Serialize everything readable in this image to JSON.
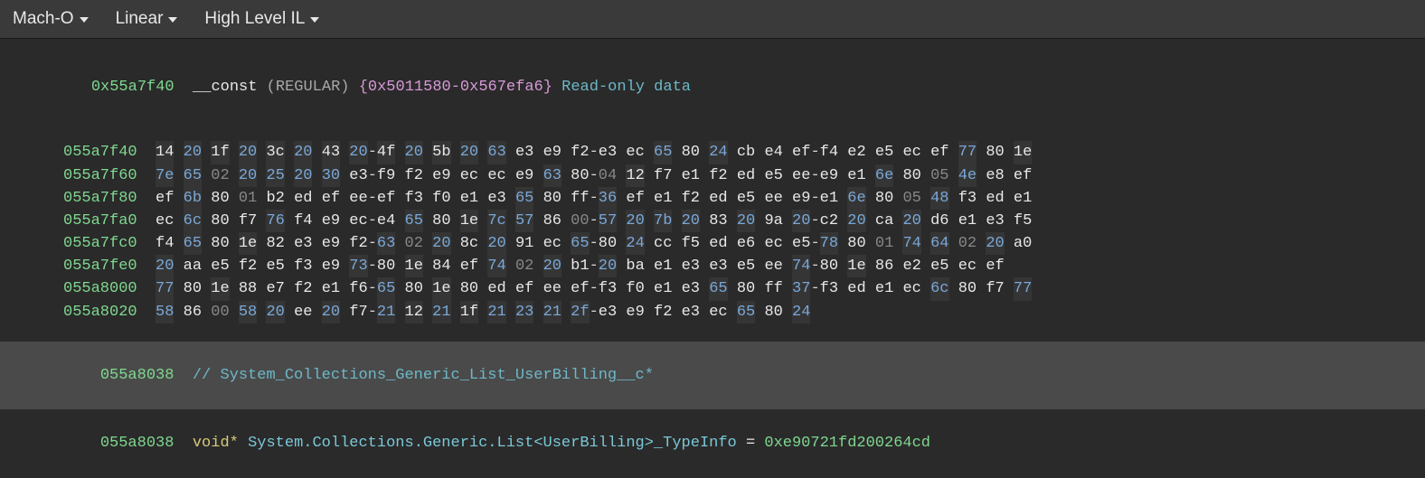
{
  "toolbar": {
    "format": "Mach-O",
    "view": "Linear",
    "il": "High Level IL"
  },
  "header": {
    "addr": "0x55a7f40",
    "section": "__const",
    "type": "(REGULAR)",
    "range": "{0x5011580-0x567efa6}",
    "desc": "Read-only data"
  },
  "rows": [
    {
      "addr": "055a7f40",
      "b": [
        {
          "v": "14",
          "c": "b-hi"
        },
        {
          "v": "20",
          "c": "b-blu"
        },
        {
          "v": "1f",
          "c": "b-hi"
        },
        {
          "v": "20",
          "c": "b-blu"
        },
        {
          "v": "3c",
          "c": "b-hi"
        },
        {
          "v": "20",
          "c": "b-blu"
        },
        {
          "v": "43",
          "c": "b-hi"
        },
        {
          "v": "20",
          "c": "b-blu",
          "d": true
        },
        {
          "v": "4f",
          "c": "b-hi"
        },
        {
          "v": "20",
          "c": "b-blu"
        },
        {
          "v": "5b",
          "c": "b-hi"
        },
        {
          "v": "20",
          "c": "b-blu"
        },
        {
          "v": "63",
          "c": "b-hib"
        },
        {
          "v": "e3",
          "c": "b-pl"
        },
        {
          "v": "e9",
          "c": "b-pl"
        },
        {
          "v": "f2",
          "c": "b-pl",
          "d": true
        },
        {
          "v": "e3",
          "c": "b-pl"
        },
        {
          "v": "ec",
          "c": "b-pl"
        },
        {
          "v": "65",
          "c": "b-hib"
        },
        {
          "v": "80",
          "c": "b-pl"
        },
        {
          "v": "24",
          "c": "b-hib"
        },
        {
          "v": "cb",
          "c": "b-pl"
        },
        {
          "v": "e4",
          "c": "b-pl"
        },
        {
          "v": "ef",
          "c": "b-pl",
          "d": true
        },
        {
          "v": "f4",
          "c": "b-pl"
        },
        {
          "v": "e2",
          "c": "b-pl"
        },
        {
          "v": "e5",
          "c": "b-pl"
        },
        {
          "v": "ec",
          "c": "b-pl"
        },
        {
          "v": "ef",
          "c": "b-pl"
        },
        {
          "v": "77",
          "c": "b-hib"
        },
        {
          "v": "80",
          "c": "b-pl"
        },
        {
          "v": "1e",
          "c": "b-hi"
        }
      ]
    },
    {
      "addr": "055a7f60",
      "b": [
        {
          "v": "7e",
          "c": "b-hib"
        },
        {
          "v": "65",
          "c": "b-hib"
        },
        {
          "v": "02",
          "c": "b-dim"
        },
        {
          "v": "20",
          "c": "b-blu"
        },
        {
          "v": "25",
          "c": "b-hib"
        },
        {
          "v": "20",
          "c": "b-blu"
        },
        {
          "v": "30",
          "c": "b-hib"
        },
        {
          "v": "e3",
          "c": "b-pl",
          "d": true
        },
        {
          "v": "f9",
          "c": "b-pl"
        },
        {
          "v": "f2",
          "c": "b-pl"
        },
        {
          "v": "e9",
          "c": "b-pl"
        },
        {
          "v": "ec",
          "c": "b-pl"
        },
        {
          "v": "ec",
          "c": "b-pl"
        },
        {
          "v": "e9",
          "c": "b-pl"
        },
        {
          "v": "63",
          "c": "b-hib"
        },
        {
          "v": "80",
          "c": "b-pl",
          "d": true
        },
        {
          "v": "04",
          "c": "b-dim"
        },
        {
          "v": "12",
          "c": "b-hi"
        },
        {
          "v": "f7",
          "c": "b-pl"
        },
        {
          "v": "e1",
          "c": "b-pl"
        },
        {
          "v": "f2",
          "c": "b-pl"
        },
        {
          "v": "ed",
          "c": "b-pl"
        },
        {
          "v": "e5",
          "c": "b-pl"
        },
        {
          "v": "ee",
          "c": "b-pl",
          "d": true
        },
        {
          "v": "e9",
          "c": "b-pl"
        },
        {
          "v": "e1",
          "c": "b-pl"
        },
        {
          "v": "6e",
          "c": "b-hib"
        },
        {
          "v": "80",
          "c": "b-pl"
        },
        {
          "v": "05",
          "c": "b-dim"
        },
        {
          "v": "4e",
          "c": "b-hib"
        },
        {
          "v": "e8",
          "c": "b-pl"
        },
        {
          "v": "ef",
          "c": "b-pl"
        }
      ]
    },
    {
      "addr": "055a7f80",
      "b": [
        {
          "v": "ef",
          "c": "b-pl"
        },
        {
          "v": "6b",
          "c": "b-hib"
        },
        {
          "v": "80",
          "c": "b-pl"
        },
        {
          "v": "01",
          "c": "b-dim"
        },
        {
          "v": "b2",
          "c": "b-pl"
        },
        {
          "v": "ed",
          "c": "b-pl"
        },
        {
          "v": "ef",
          "c": "b-pl"
        },
        {
          "v": "ee",
          "c": "b-pl",
          "d": true
        },
        {
          "v": "ef",
          "c": "b-pl"
        },
        {
          "v": "f3",
          "c": "b-pl"
        },
        {
          "v": "f0",
          "c": "b-pl"
        },
        {
          "v": "e1",
          "c": "b-pl"
        },
        {
          "v": "e3",
          "c": "b-pl"
        },
        {
          "v": "65",
          "c": "b-hib"
        },
        {
          "v": "80",
          "c": "b-pl"
        },
        {
          "v": "ff",
          "c": "b-pl",
          "d": true
        },
        {
          "v": "36",
          "c": "b-hib"
        },
        {
          "v": "ef",
          "c": "b-pl"
        },
        {
          "v": "e1",
          "c": "b-pl"
        },
        {
          "v": "f2",
          "c": "b-pl"
        },
        {
          "v": "ed",
          "c": "b-pl"
        },
        {
          "v": "e5",
          "c": "b-pl"
        },
        {
          "v": "ee",
          "c": "b-pl"
        },
        {
          "v": "e9",
          "c": "b-pl",
          "d": true
        },
        {
          "v": "e1",
          "c": "b-pl"
        },
        {
          "v": "6e",
          "c": "b-hib"
        },
        {
          "v": "80",
          "c": "b-pl"
        },
        {
          "v": "05",
          "c": "b-dim"
        },
        {
          "v": "48",
          "c": "b-hib"
        },
        {
          "v": "f3",
          "c": "b-pl"
        },
        {
          "v": "ed",
          "c": "b-pl"
        },
        {
          "v": "e1",
          "c": "b-pl"
        }
      ]
    },
    {
      "addr": "055a7fa0",
      "b": [
        {
          "v": "ec",
          "c": "b-pl"
        },
        {
          "v": "6c",
          "c": "b-hib"
        },
        {
          "v": "80",
          "c": "b-pl"
        },
        {
          "v": "f7",
          "c": "b-pl"
        },
        {
          "v": "76",
          "c": "b-hib"
        },
        {
          "v": "f4",
          "c": "b-pl"
        },
        {
          "v": "e9",
          "c": "b-pl"
        },
        {
          "v": "ec",
          "c": "b-pl",
          "d": true
        },
        {
          "v": "e4",
          "c": "b-pl"
        },
        {
          "v": "65",
          "c": "b-hib"
        },
        {
          "v": "80",
          "c": "b-pl"
        },
        {
          "v": "1e",
          "c": "b-hi"
        },
        {
          "v": "7c",
          "c": "b-hib"
        },
        {
          "v": "57",
          "c": "b-hib"
        },
        {
          "v": "86",
          "c": "b-pl"
        },
        {
          "v": "00",
          "c": "b-dim",
          "d": true
        },
        {
          "v": "57",
          "c": "b-hib"
        },
        {
          "v": "20",
          "c": "b-blu"
        },
        {
          "v": "7b",
          "c": "b-hib"
        },
        {
          "v": "20",
          "c": "b-blu"
        },
        {
          "v": "83",
          "c": "b-pl"
        },
        {
          "v": "20",
          "c": "b-blu"
        },
        {
          "v": "9a",
          "c": "b-pl"
        },
        {
          "v": "20",
          "c": "b-blu",
          "d": true
        },
        {
          "v": "c2",
          "c": "b-pl"
        },
        {
          "v": "20",
          "c": "b-blu"
        },
        {
          "v": "ca",
          "c": "b-pl"
        },
        {
          "v": "20",
          "c": "b-blu"
        },
        {
          "v": "d6",
          "c": "b-pl"
        },
        {
          "v": "e1",
          "c": "b-pl"
        },
        {
          "v": "e3",
          "c": "b-pl"
        },
        {
          "v": "f5",
          "c": "b-pl"
        }
      ]
    },
    {
      "addr": "055a7fc0",
      "b": [
        {
          "v": "f4",
          "c": "b-pl"
        },
        {
          "v": "65",
          "c": "b-hib"
        },
        {
          "v": "80",
          "c": "b-pl"
        },
        {
          "v": "1e",
          "c": "b-hi"
        },
        {
          "v": "82",
          "c": "b-pl"
        },
        {
          "v": "e3",
          "c": "b-pl"
        },
        {
          "v": "e9",
          "c": "b-pl"
        },
        {
          "v": "f2",
          "c": "b-pl",
          "d": true
        },
        {
          "v": "63",
          "c": "b-hib"
        },
        {
          "v": "02",
          "c": "b-dim"
        },
        {
          "v": "20",
          "c": "b-blu"
        },
        {
          "v": "8c",
          "c": "b-pl"
        },
        {
          "v": "20",
          "c": "b-blu"
        },
        {
          "v": "91",
          "c": "b-pl"
        },
        {
          "v": "ec",
          "c": "b-pl"
        },
        {
          "v": "65",
          "c": "b-hib",
          "d": true
        },
        {
          "v": "80",
          "c": "b-pl"
        },
        {
          "v": "24",
          "c": "b-hib"
        },
        {
          "v": "cc",
          "c": "b-pl"
        },
        {
          "v": "f5",
          "c": "b-pl"
        },
        {
          "v": "ed",
          "c": "b-pl"
        },
        {
          "v": "e6",
          "c": "b-pl"
        },
        {
          "v": "ec",
          "c": "b-pl"
        },
        {
          "v": "e5",
          "c": "b-pl",
          "d": true
        },
        {
          "v": "78",
          "c": "b-hib"
        },
        {
          "v": "80",
          "c": "b-pl"
        },
        {
          "v": "01",
          "c": "b-dim"
        },
        {
          "v": "74",
          "c": "b-hib"
        },
        {
          "v": "64",
          "c": "b-hib"
        },
        {
          "v": "02",
          "c": "b-dim"
        },
        {
          "v": "20",
          "c": "b-blu"
        },
        {
          "v": "a0",
          "c": "b-pl"
        }
      ]
    },
    {
      "addr": "055a7fe0",
      "b": [
        {
          "v": "20",
          "c": "b-blu"
        },
        {
          "v": "aa",
          "c": "b-pl"
        },
        {
          "v": "e5",
          "c": "b-pl"
        },
        {
          "v": "f2",
          "c": "b-pl"
        },
        {
          "v": "e5",
          "c": "b-pl"
        },
        {
          "v": "f3",
          "c": "b-pl"
        },
        {
          "v": "e9",
          "c": "b-pl"
        },
        {
          "v": "73",
          "c": "b-hib",
          "d": true
        },
        {
          "v": "80",
          "c": "b-pl"
        },
        {
          "v": "1e",
          "c": "b-hi"
        },
        {
          "v": "84",
          "c": "b-pl"
        },
        {
          "v": "ef",
          "c": "b-pl"
        },
        {
          "v": "74",
          "c": "b-hib"
        },
        {
          "v": "02",
          "c": "b-dim"
        },
        {
          "v": "20",
          "c": "b-blu"
        },
        {
          "v": "b1",
          "c": "b-pl",
          "d": true
        },
        {
          "v": "20",
          "c": "b-blu"
        },
        {
          "v": "ba",
          "c": "b-pl"
        },
        {
          "v": "e1",
          "c": "b-pl"
        },
        {
          "v": "e3",
          "c": "b-pl"
        },
        {
          "v": "e3",
          "c": "b-pl"
        },
        {
          "v": "e5",
          "c": "b-pl"
        },
        {
          "v": "ee",
          "c": "b-pl"
        },
        {
          "v": "74",
          "c": "b-hib",
          "d": true
        },
        {
          "v": "80",
          "c": "b-pl"
        },
        {
          "v": "1e",
          "c": "b-hi"
        },
        {
          "v": "86",
          "c": "b-pl"
        },
        {
          "v": "e2",
          "c": "b-pl"
        },
        {
          "v": "e5",
          "c": "b-pl"
        },
        {
          "v": "ec",
          "c": "b-pl"
        },
        {
          "v": "ef",
          "c": "b-pl"
        }
      ]
    },
    {
      "addr": "055a8000",
      "b": [
        {
          "v": "77",
          "c": "b-hib"
        },
        {
          "v": "80",
          "c": "b-pl"
        },
        {
          "v": "1e",
          "c": "b-hi"
        },
        {
          "v": "88",
          "c": "b-pl"
        },
        {
          "v": "e7",
          "c": "b-pl"
        },
        {
          "v": "f2",
          "c": "b-pl"
        },
        {
          "v": "e1",
          "c": "b-pl"
        },
        {
          "v": "f6",
          "c": "b-pl",
          "d": true
        },
        {
          "v": "65",
          "c": "b-hib"
        },
        {
          "v": "80",
          "c": "b-pl"
        },
        {
          "v": "1e",
          "c": "b-hi"
        },
        {
          "v": "80",
          "c": "b-pl"
        },
        {
          "v": "ed",
          "c": "b-pl"
        },
        {
          "v": "ef",
          "c": "b-pl"
        },
        {
          "v": "ee",
          "c": "b-pl"
        },
        {
          "v": "ef",
          "c": "b-pl",
          "d": true
        },
        {
          "v": "f3",
          "c": "b-pl"
        },
        {
          "v": "f0",
          "c": "b-pl"
        },
        {
          "v": "e1",
          "c": "b-pl"
        },
        {
          "v": "e3",
          "c": "b-pl"
        },
        {
          "v": "65",
          "c": "b-hib"
        },
        {
          "v": "80",
          "c": "b-pl"
        },
        {
          "v": "ff",
          "c": "b-pl"
        },
        {
          "v": "37",
          "c": "b-hib",
          "d": true
        },
        {
          "v": "f3",
          "c": "b-pl"
        },
        {
          "v": "ed",
          "c": "b-pl"
        },
        {
          "v": "e1",
          "c": "b-pl"
        },
        {
          "v": "ec",
          "c": "b-pl"
        },
        {
          "v": "6c",
          "c": "b-hib"
        },
        {
          "v": "80",
          "c": "b-pl"
        },
        {
          "v": "f7",
          "c": "b-pl"
        },
        {
          "v": "77",
          "c": "b-hib"
        }
      ]
    },
    {
      "addr": "055a8020",
      "b": [
        {
          "v": "58",
          "c": "b-hib"
        },
        {
          "v": "86",
          "c": "b-pl"
        },
        {
          "v": "00",
          "c": "b-dim"
        },
        {
          "v": "58",
          "c": "b-hib"
        },
        {
          "v": "20",
          "c": "b-blu"
        },
        {
          "v": "ee",
          "c": "b-pl"
        },
        {
          "v": "20",
          "c": "b-blu"
        },
        {
          "v": "f7",
          "c": "b-pl",
          "d": true
        },
        {
          "v": "21",
          "c": "b-hib"
        },
        {
          "v": "12",
          "c": "b-hi"
        },
        {
          "v": "21",
          "c": "b-hib"
        },
        {
          "v": "1f",
          "c": "b-hi"
        },
        {
          "v": "21",
          "c": "b-hib"
        },
        {
          "v": "23",
          "c": "b-hib"
        },
        {
          "v": "21",
          "c": "b-hib"
        },
        {
          "v": "2f",
          "c": "b-hib",
          "d": true
        },
        {
          "v": "e3",
          "c": "b-pl"
        },
        {
          "v": "e9",
          "c": "b-pl"
        },
        {
          "v": "f2",
          "c": "b-pl"
        },
        {
          "v": "e3",
          "c": "b-pl"
        },
        {
          "v": "ec",
          "c": "b-pl"
        },
        {
          "v": "65",
          "c": "b-hib"
        },
        {
          "v": "80",
          "c": "b-pl"
        },
        {
          "v": "24",
          "c": "b-hib"
        }
      ]
    }
  ],
  "comment": {
    "addr": "055a8038",
    "text": "// System_Collections_Generic_List_UserBilling__c*"
  },
  "symbol": {
    "addr": "055a8038",
    "type": "void*",
    "name": "System.Collections.Generic.List<UserBilling>_TypeInfo",
    "eq": " = ",
    "value": "0xe90721fd200264cd"
  }
}
